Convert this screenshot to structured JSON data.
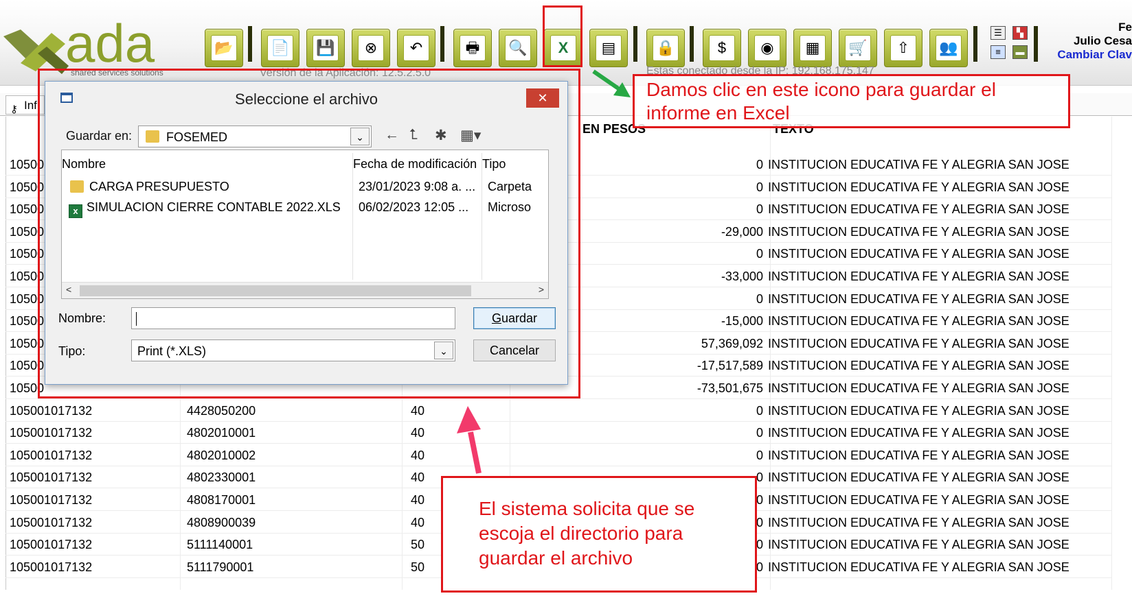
{
  "app": {
    "logo_text": "ada",
    "tagline": "shared services solutions",
    "version_label": "Versión de la Aplicación: 12.5.2.5.0",
    "ip_label": "Estas conectado desde la IP: 192.168.175.147",
    "user_top": "Fe",
    "user_name": "Julio Cesa",
    "change_password": "Cambiar Clav"
  },
  "toolbar": {
    "buttons": [
      {
        "name": "open-folder",
        "glyph": "📂"
      },
      {
        "name": "new-document",
        "glyph": "📄"
      },
      {
        "name": "save",
        "glyph": "💾"
      },
      {
        "name": "delete",
        "glyph": "⊗"
      },
      {
        "name": "undo",
        "glyph": "↶"
      },
      {
        "name": "print",
        "glyph": "🖶"
      },
      {
        "name": "preview",
        "glyph": "🔍"
      },
      {
        "name": "export-excel",
        "glyph": "X"
      },
      {
        "name": "money-transfer",
        "glyph": "▤"
      },
      {
        "name": "lock",
        "glyph": "🔒"
      },
      {
        "name": "money-bag",
        "glyph": "$"
      },
      {
        "name": "camera",
        "glyph": "◉"
      },
      {
        "name": "calculator",
        "glyph": "▦"
      },
      {
        "name": "cart",
        "glyph": "🛒"
      },
      {
        "name": "upload",
        "glyph": "⇧"
      },
      {
        "name": "users",
        "glyph": "👥"
      }
    ]
  },
  "tab": {
    "label": "Inf"
  },
  "grid": {
    "headers": {
      "amount": "EN PESOS",
      "text": "TEXTO"
    },
    "rows": [
      {
        "acct": "10500",
        "code": "",
        "cls": "",
        "amount": "0",
        "text": "INSTITUCION EDUCATIVA FE Y ALEGRIA SAN JOSE"
      },
      {
        "acct": "10500",
        "code": "",
        "cls": "",
        "amount": "0",
        "text": "INSTITUCION EDUCATIVA FE Y ALEGRIA SAN JOSE"
      },
      {
        "acct": "10500",
        "code": "",
        "cls": "",
        "amount": "0",
        "text": "INSTITUCION EDUCATIVA FE Y ALEGRIA SAN JOSE"
      },
      {
        "acct": "10500",
        "code": "",
        "cls": "",
        "amount": "-29,000",
        "text": "INSTITUCION EDUCATIVA FE Y ALEGRIA SAN JOSE"
      },
      {
        "acct": "10500",
        "code": "",
        "cls": "",
        "amount": "0",
        "text": "INSTITUCION EDUCATIVA FE Y ALEGRIA SAN JOSE"
      },
      {
        "acct": "10500",
        "code": "",
        "cls": "",
        "amount": "-33,000",
        "text": "INSTITUCION EDUCATIVA FE Y ALEGRIA SAN JOSE"
      },
      {
        "acct": "10500",
        "code": "",
        "cls": "",
        "amount": "0",
        "text": "INSTITUCION EDUCATIVA FE Y ALEGRIA SAN JOSE"
      },
      {
        "acct": "10500",
        "code": "",
        "cls": "",
        "amount": "-15,000",
        "text": "INSTITUCION EDUCATIVA FE Y ALEGRIA SAN JOSE"
      },
      {
        "acct": "10500",
        "code": "",
        "cls": "",
        "amount": "57,369,092",
        "text": "INSTITUCION EDUCATIVA FE Y ALEGRIA SAN JOSE"
      },
      {
        "acct": "10500",
        "code": "",
        "cls": "",
        "amount": "-17,517,589",
        "text": "INSTITUCION EDUCATIVA FE Y ALEGRIA SAN JOSE"
      },
      {
        "acct": "10500",
        "code": "",
        "cls": "",
        "amount": "-73,501,675",
        "text": "INSTITUCION EDUCATIVA FE Y ALEGRIA SAN JOSE"
      },
      {
        "acct": "105001017132",
        "code": "4428050200",
        "cls": "40",
        "amount": "0",
        "text": "INSTITUCION EDUCATIVA FE Y ALEGRIA SAN JOSE"
      },
      {
        "acct": "105001017132",
        "code": "4802010001",
        "cls": "40",
        "amount": "0",
        "text": "INSTITUCION EDUCATIVA FE Y ALEGRIA SAN JOSE"
      },
      {
        "acct": "105001017132",
        "code": "4802010002",
        "cls": "40",
        "amount": "0",
        "text": "INSTITUCION EDUCATIVA FE Y ALEGRIA SAN JOSE"
      },
      {
        "acct": "105001017132",
        "code": "4802330001",
        "cls": "40",
        "amount": "0",
        "text": "INSTITUCION EDUCATIVA FE Y ALEGRIA SAN JOSE"
      },
      {
        "acct": "105001017132",
        "code": "4808170001",
        "cls": "40",
        "amount": "0",
        "text": "INSTITUCION EDUCATIVA FE Y ALEGRIA SAN JOSE"
      },
      {
        "acct": "105001017132",
        "code": "4808900039",
        "cls": "40",
        "amount": "0",
        "text": "INSTITUCION EDUCATIVA FE Y ALEGRIA SAN JOSE"
      },
      {
        "acct": "105001017132",
        "code": "5111140001",
        "cls": "50",
        "amount": "0",
        "text": "INSTITUCION EDUCATIVA FE Y ALEGRIA SAN JOSE"
      },
      {
        "acct": "105001017132",
        "code": "5111790001",
        "cls": "50",
        "amount": "0",
        "text": "INSTITUCION EDUCATIVA FE Y ALEGRIA SAN JOSE"
      }
    ]
  },
  "dialog": {
    "title": "Seleccione el archivo",
    "close_glyph": "✕",
    "save_in_label": "Guardar en:",
    "folder": "FOSEMED",
    "columns": {
      "name": "Nombre",
      "modified": "Fecha de modificación",
      "type": "Tipo"
    },
    "files": [
      {
        "name": "CARGA PRESUPUESTO",
        "modified": "23/01/2023 9:08 a. ...",
        "type": "Carpeta",
        "icon": "folder"
      },
      {
        "name": "SIMULACION CIERRE CONTABLE 2022.XLS",
        "modified": "06/02/2023 12:05 ...",
        "type": "Microso",
        "icon": "excel-file"
      }
    ],
    "name_label": "Nombre:",
    "name_value": "",
    "type_label": "Tipo:",
    "type_value": "Print (*.XLS)",
    "save_button_first": "G",
    "save_button_rest": "uardar",
    "cancel_button": "Cancelar"
  },
  "annotations": {
    "excel_callout_line1": "Damos clic en este icono para guardar el",
    "excel_callout_line2": "informe en Excel",
    "dialog_callout_line1": "El sistema solicita que se",
    "dialog_callout_line2": "escoja el directorio para",
    "dialog_callout_line3": "guardar el archivo",
    "color": "#e0161a",
    "green_arrow_color": "#27a844",
    "pink_arrow_color": "#f23a6b"
  }
}
